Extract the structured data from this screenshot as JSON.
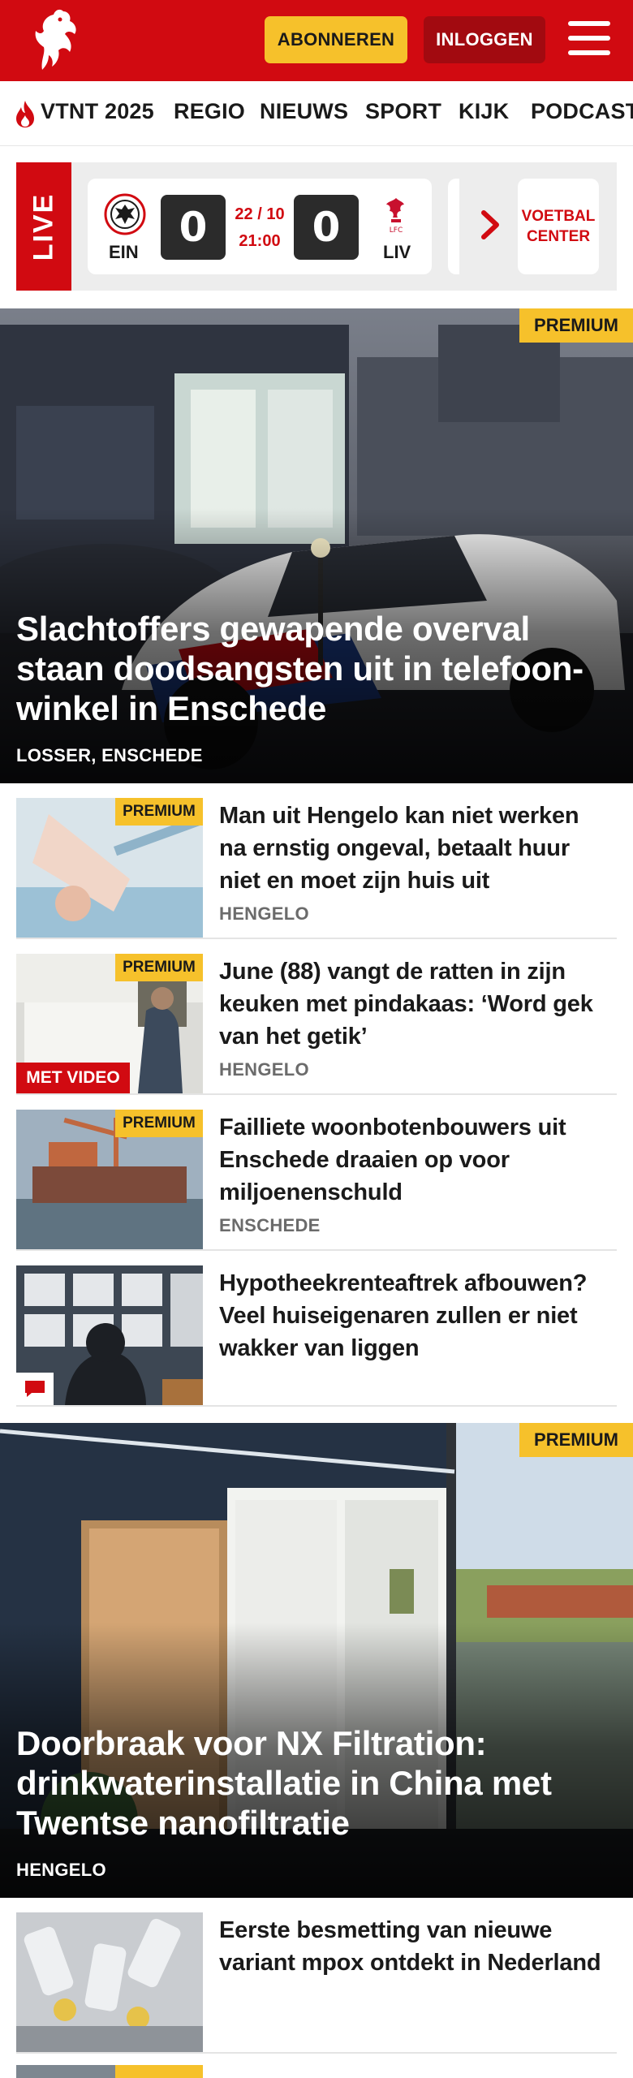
{
  "header": {
    "logo_name": "tubantia-horse-logo",
    "subscribe_label": "ABONNEREN",
    "login_label": "INLOGGEN",
    "brand_color": "#d10a11",
    "accent_color": "#f6c12b"
  },
  "nav": {
    "items": [
      {
        "label": "VTNT 2025",
        "icon": "flame-icon"
      },
      {
        "label": "REGIO"
      },
      {
        "label": "NIEUWS"
      },
      {
        "label": "SPORT"
      },
      {
        "label": "KIJK"
      },
      {
        "label": "PODCAST"
      }
    ]
  },
  "live": {
    "label": "LIVE",
    "match": {
      "home_team": "EIN",
      "home_score": "0",
      "away_team": "LIV",
      "away_score": "0",
      "date": "22 / 10",
      "time": "21:00"
    },
    "voetbal_center_label": "VOETBAL CENTER"
  },
  "articles": {
    "hero1": {
      "badge": "PREMIUM",
      "title": "Slachtoffers gewapende overval staan doodsangsten uit in telefoon­winkel in Enschede",
      "location": "LOSSER, ENSCHEDE"
    },
    "list1": [
      {
        "badge": "PREMIUM",
        "title": "Man uit Hengelo kan niet werken na ernstig ongeval, betaalt huur niet en moet zijn huis uit",
        "location": "HENGELO"
      },
      {
        "badge": "PREMIUM",
        "video": "MET VIDEO",
        "title": "June (88) vangt de ratten in zijn keuken met pindakaas: ‘Word gek van het getik’",
        "location": "HENGELO"
      },
      {
        "badge": "PREMIUM",
        "title": "Failliete woonbotenbouwers uit Enschede draaien op voor miljoenenschuld",
        "location": "ENSCHEDE"
      },
      {
        "title": "Hypotheekrenteaftrek afbouwen? Veel huiseigenaren zullen er niet wakker van liggen",
        "comment_icon": "comment-icon"
      }
    ],
    "hero2": {
      "badge": "PREMIUM",
      "title": "Doorbraak voor NX Filtration: drinkwaterinstallatie in China met Twentse nanofiltratie",
      "location": "HENGELO"
    },
    "list2": [
      {
        "title": "Eerste besmetting van nieuwe variant mpox ontdekt in Nederland"
      }
    ]
  }
}
